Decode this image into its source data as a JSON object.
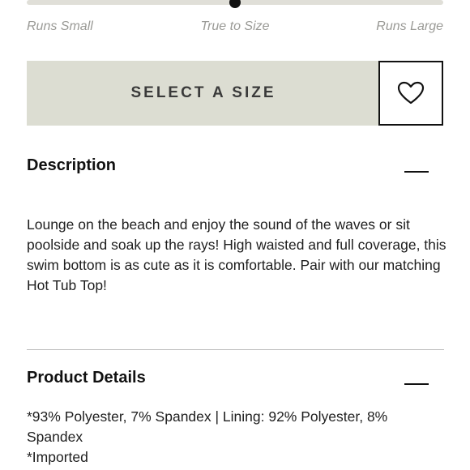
{
  "fit_scale": {
    "labels": {
      "small": "Runs Small",
      "true": "True to Size",
      "large": "Runs Large"
    },
    "selected_fraction": 0.5
  },
  "actions": {
    "select_size_label": "SELECT A SIZE",
    "wishlist_icon": "heart-icon"
  },
  "description": {
    "title": "Description",
    "toggle_icon": "minus-icon",
    "body": "Lounge on the beach and enjoy the sound of the waves or sit poolside and soak up the rays! High waisted and full coverage, this swim bottom is as cute as it is comfortable. Pair with our matching Hot Tub Top!"
  },
  "product_details": {
    "title": "Product Details",
    "toggle_icon": "minus-icon",
    "lines": [
      "*93% Polyester, 7% Spandex | Lining: 92% Polyester, 8% Spandex",
      "*Imported"
    ]
  },
  "colors": {
    "button_bg": "#dcddd2",
    "text": "#1c1c1c",
    "muted": "#9a9a96"
  }
}
